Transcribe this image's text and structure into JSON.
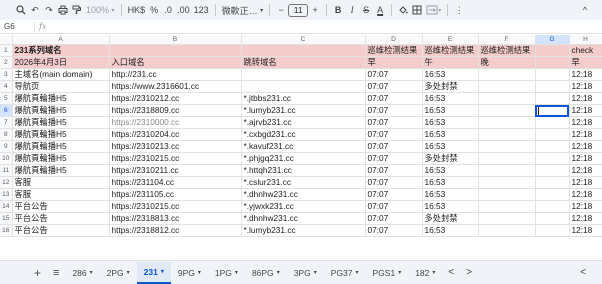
{
  "toolbar": {
    "zoom": "100%",
    "currency": "HK$",
    "percent": "%",
    "dec_decrease": ".0",
    "dec_increase": ".00",
    "number_format": "123",
    "font": "微軟正…",
    "font_size": "11",
    "bold": "B",
    "italic": "I",
    "underline_a": "A",
    "more": "⋮",
    "collapse": "^"
  },
  "formula_bar": {
    "cell_ref": "G6",
    "fx": "fx",
    "value": ""
  },
  "columns": [
    "A",
    "B",
    "C",
    "D",
    "E",
    "F",
    "G",
    "H"
  ],
  "header_row1": [
    "231系列域名",
    "",
    "",
    "巡维检测结果",
    "巡维检测结果",
    "巡维检测结果",
    "",
    "check"
  ],
  "header_row2": [
    "2026年4月3日",
    "入口域名",
    "跳转域名",
    "早",
    "午",
    "晚",
    "",
    "早"
  ],
  "rows": [
    {
      "n": "3",
      "a": "主域名(main domain)",
      "b": "http://231.cc",
      "c": "",
      "d": "07:07",
      "e": "16:53",
      "h": "12:18"
    },
    {
      "n": "4",
      "a": "导航页",
      "b": "https://www.2316601.cc",
      "c": "",
      "d": "07:07",
      "e": "多处封禁",
      "h": "12:18"
    },
    {
      "n": "5",
      "a": "爆航頁輪播H5",
      "b": "https://2310212.cc",
      "c": "*.jtbbs231.cc",
      "d": "07:07",
      "e": "16:53",
      "h": "12:18"
    },
    {
      "n": "6",
      "a": "爆航頁輪播H5",
      "b": "https://2318809.cc",
      "c": "*.lumyb231.cc",
      "d": "07:07",
      "e": "16:53",
      "h": "12:18"
    },
    {
      "n": "7",
      "a": "爆航頁輪播H5",
      "b": "https://2310000.cc",
      "c": "*.ajrvb231.cc",
      "d": "07:07",
      "e": "16:53",
      "h": "12:18"
    },
    {
      "n": "8",
      "a": "爆航頁輪播H5",
      "b": "https://2310204.cc",
      "c": "*.cxbgd231.cc",
      "d": "07:07",
      "e": "16:53",
      "h": "12:18"
    },
    {
      "n": "9",
      "a": "爆航頁輪播H5",
      "b": "https://2310213.cc",
      "c": "*.kavuf231.cc",
      "d": "07:07",
      "e": "16:53",
      "h": "12:18"
    },
    {
      "n": "10",
      "a": "爆航頁輪播H5",
      "b": "https://2310215.cc",
      "c": "*.phjgq231.cc",
      "d": "07:07",
      "e": "多处封禁",
      "h": "12:18"
    },
    {
      "n": "11",
      "a": "爆航頁輪播H5",
      "b": "https://2310211.cc",
      "c": "*.httqh231.cc",
      "d": "07:07",
      "e": "16:53",
      "h": "12:18"
    },
    {
      "n": "12",
      "a": "客服",
      "b": "https://231104.cc",
      "c": "*.cslur231.cc",
      "d": "07:07",
      "e": "16:53",
      "h": "12:18"
    },
    {
      "n": "13",
      "a": "客服",
      "b": "https://231105.cc",
      "c": "*.dhnhw231.cc",
      "d": "07:07",
      "e": "16:53",
      "h": "12:18"
    },
    {
      "n": "14",
      "a": "平台公告",
      "b": "https://2310215.cc",
      "c": "*.yjwxk231.cc",
      "d": "07:07",
      "e": "16:53",
      "h": "12:18"
    },
    {
      "n": "15",
      "a": "平台公告",
      "b": "https://2318813.cc",
      "c": "*.dhnhw231.cc",
      "d": "07:07",
      "e": "多处封禁",
      "h": "12:18"
    },
    {
      "n": "16",
      "a": "平台公告",
      "b": "https://2318812.cc",
      "c": "*.lumyb231.cc",
      "d": "07:07",
      "e": "16:53",
      "h": "12:18"
    }
  ],
  "tabs": {
    "add": "+",
    "list": "≡",
    "items": [
      "286",
      "2PG",
      "231",
      "9PG",
      "1PG",
      "86PG",
      "3PG",
      "PG37",
      "PGS1",
      "182"
    ],
    "active": "231",
    "prev": "<",
    "next": ">",
    "collapse": "<"
  },
  "colors": {
    "header_fill": "#f4cccc",
    "selection": "#0b57d0",
    "toolbar_bg": "#f0f4f9"
  }
}
